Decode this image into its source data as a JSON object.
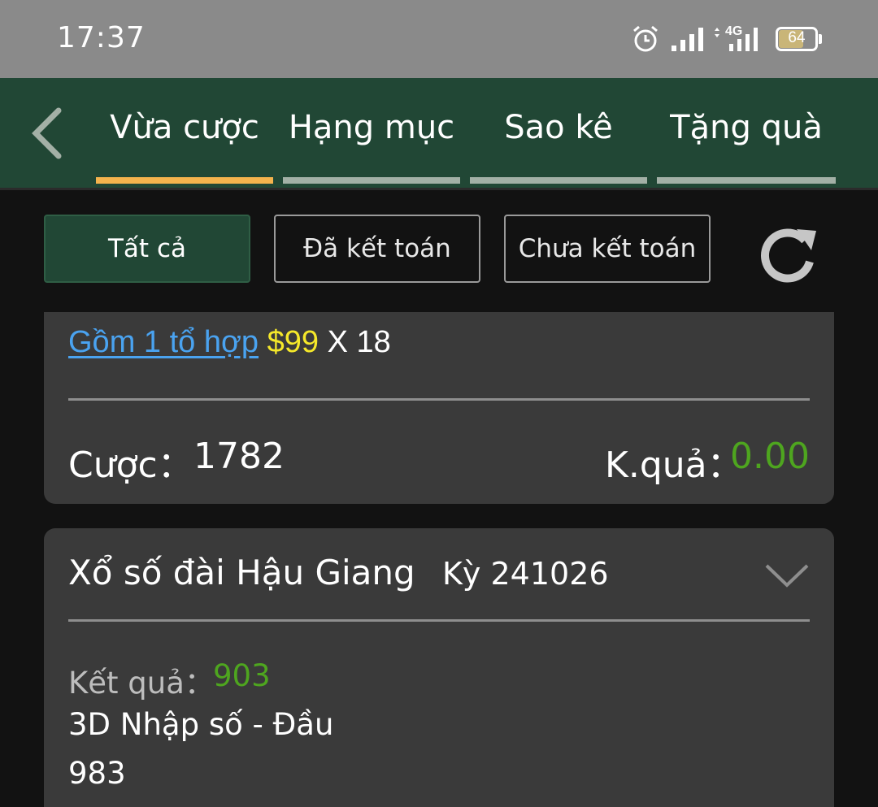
{
  "status_bar": {
    "time": "17:37",
    "network": "4G",
    "battery": "64",
    "icons": [
      "alarm-icon",
      "signal-icon",
      "4g-signal-icon",
      "battery-icon"
    ]
  },
  "nav": {
    "back_icon": "chevron-left-icon",
    "tabs": [
      {
        "label": "Vừa cược",
        "active": true
      },
      {
        "label": "Hạng mục",
        "active": false
      },
      {
        "label": "Sao kê",
        "active": false
      },
      {
        "label": "Tặng quà",
        "active": false
      }
    ]
  },
  "filters": {
    "items": [
      {
        "label": "Tất cả",
        "active": true
      },
      {
        "label": "Đã kết toán",
        "active": false
      },
      {
        "label": "Chưa kết toán",
        "active": false
      }
    ],
    "refresh_icon": "refresh-icon"
  },
  "bet_card": {
    "combo_link": "Gồm 1 tổ hợp",
    "price": "$99",
    "multiplier": "X 18",
    "bet_label": "Cược：",
    "bet_value": "1782",
    "result_label": "K.quả：",
    "result_value": "0.00"
  },
  "lottery_card": {
    "title": "Xổ số đài Hậu Giang",
    "period": "Kỳ 241026",
    "expand_icon": "chevron-down-icon",
    "draw_label": "Kết quả：",
    "draw_value": "903",
    "bet_type": "3D Nhập số - Đầu",
    "bet_number": "983"
  },
  "colors": {
    "nav_bg": "#214735",
    "active_tab_indicator": "#f4b34d",
    "link": "#4aa3f0",
    "price": "#f5e82a",
    "positive": "#4ea51f",
    "card_bg": "#3a3a3a",
    "page_bg": "#121212"
  }
}
